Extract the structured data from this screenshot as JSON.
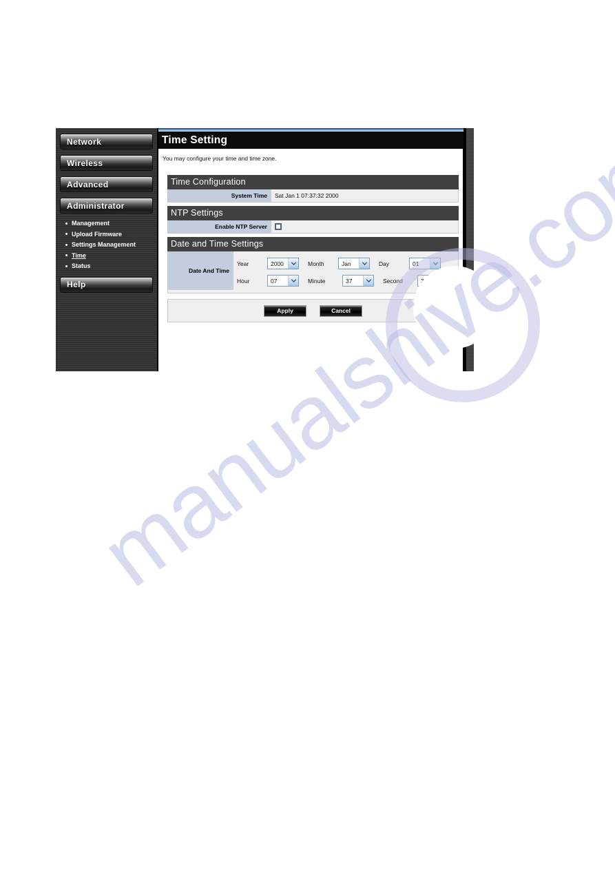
{
  "watermark": {
    "text": "manualshive.com"
  },
  "sidebar": {
    "nav_buttons": [
      {
        "label": "Network"
      },
      {
        "label": "Wireless"
      },
      {
        "label": "Advanced"
      },
      {
        "label": "Administrator"
      }
    ],
    "submenu": [
      {
        "label": "Management",
        "active": false
      },
      {
        "label": "Upload Firmware",
        "active": false
      },
      {
        "label": "Settings Management",
        "active": false
      },
      {
        "label": "Time",
        "active": true
      },
      {
        "label": "Status",
        "active": false
      }
    ],
    "help_button": {
      "label": "Help"
    }
  },
  "page": {
    "title": "Time Setting",
    "intro": "You may configure your time and time zone."
  },
  "sections": {
    "time_configuration": {
      "heading": "Time Configuration",
      "system_time_label": "System Time",
      "system_time_value": "Sat Jan 1 07:37:32 2000"
    },
    "ntp_settings": {
      "heading": "NTP Settings",
      "enable_ntp_label": "Enable NTP Server",
      "enable_ntp_checked": false
    },
    "date_time_settings": {
      "heading": "Date and Time Settings",
      "row_label": "Date And Time",
      "fields": [
        {
          "caption": "Year",
          "value": "2000"
        },
        {
          "caption": "Month",
          "value": "Jan"
        },
        {
          "caption": "Day",
          "value": "01"
        },
        {
          "caption": "Hour",
          "value": "07"
        },
        {
          "caption": "Minute",
          "value": "37"
        },
        {
          "caption": "Second",
          "value": "31"
        }
      ]
    }
  },
  "buttons": {
    "apply": "Apply",
    "cancel": "Cancel"
  },
  "colors": {
    "section_header_bg": "#414141",
    "label_cell_bg": "#c3cddd",
    "title_bar_bg": "#0c0c0c",
    "watermark": "#b9bce4"
  }
}
